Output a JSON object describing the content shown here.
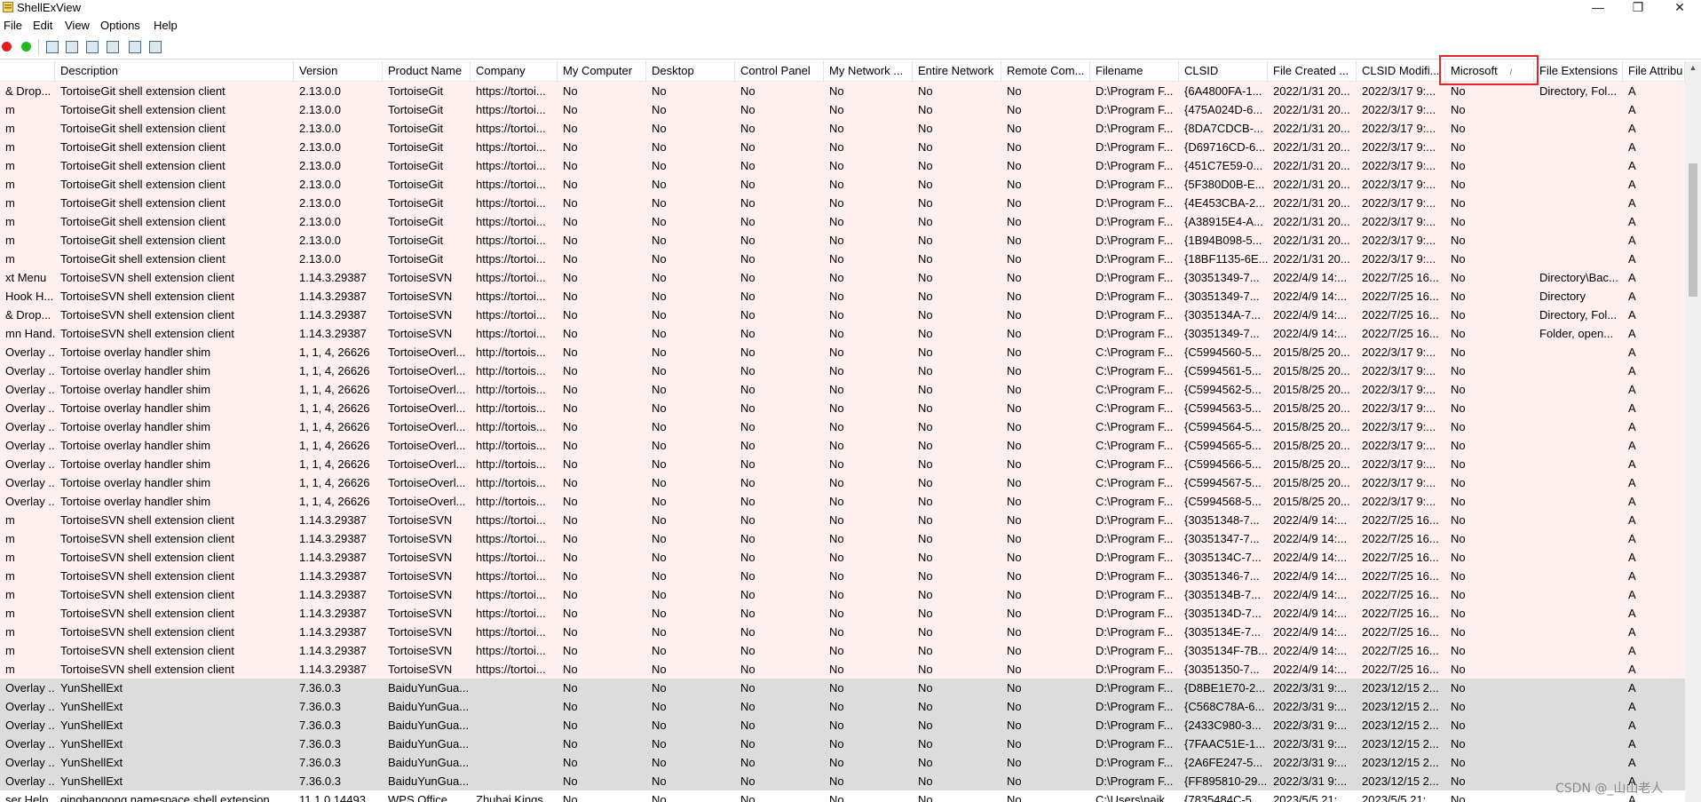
{
  "app": {
    "title": "ShellExView"
  },
  "window_controls": {
    "minimize": "—",
    "maximize": "❐",
    "close": "✕"
  },
  "menu": [
    "File",
    "Edit",
    "View",
    "Options",
    "Help"
  ],
  "toolbar": {
    "icons": [
      "disable-red-icon",
      "enable-green-icon",
      "save-icon",
      "refresh-icon",
      "copy-icon",
      "properties-icon",
      "html-report-icon",
      "exit-icon"
    ],
    "colors": {
      "red": "#e02020",
      "green": "#1fb81f"
    }
  },
  "columns": [
    "",
    "Description",
    "Version",
    "Product Name",
    "Company",
    "My Computer",
    "Desktop",
    "Control Panel",
    "My Network ...",
    "Entire Network",
    "Remote Com...",
    "Filename",
    "CLSID",
    "File Created ...",
    "CLSID Modifi...",
    "Microsoft",
    "File Extensions",
    "File Attribu"
  ],
  "sorted_column": "Microsoft",
  "sort_indicator": "/",
  "colors": {
    "pink_row": "#fff0f0",
    "gray_row": "#dcdcdc",
    "highlight": "#e1262d"
  },
  "rows": [
    {
      "style": "pink",
      "cells": [
        "& Drop...",
        "TortoiseGit shell extension client",
        "2.13.0.0",
        "TortoiseGit",
        "https://tortoi...",
        "No",
        "No",
        "No",
        "No",
        "No",
        "No",
        "D:\\Program F...",
        "{6A4800FA-1...",
        "2022/1/31 20...",
        "2022/3/17 9:...",
        "No",
        "Directory, Fol...",
        "A"
      ]
    },
    {
      "style": "pink",
      "cells": [
        "m",
        "TortoiseGit shell extension client",
        "2.13.0.0",
        "TortoiseGit",
        "https://tortoi...",
        "No",
        "No",
        "No",
        "No",
        "No",
        "No",
        "D:\\Program F...",
        "{475A024D-6...",
        "2022/1/31 20...",
        "2022/3/17 9:...",
        "No",
        "",
        "A"
      ]
    },
    {
      "style": "pink",
      "cells": [
        "m",
        "TortoiseGit shell extension client",
        "2.13.0.0",
        "TortoiseGit",
        "https://tortoi...",
        "No",
        "No",
        "No",
        "No",
        "No",
        "No",
        "D:\\Program F...",
        "{8DA7CDCB-...",
        "2022/1/31 20...",
        "2022/3/17 9:...",
        "No",
        "",
        "A"
      ]
    },
    {
      "style": "pink",
      "cells": [
        "m",
        "TortoiseGit shell extension client",
        "2.13.0.0",
        "TortoiseGit",
        "https://tortoi...",
        "No",
        "No",
        "No",
        "No",
        "No",
        "No",
        "D:\\Program F...",
        "{D69716CD-6...",
        "2022/1/31 20...",
        "2022/3/17 9:...",
        "No",
        "",
        "A"
      ]
    },
    {
      "style": "pink",
      "cells": [
        "m",
        "TortoiseGit shell extension client",
        "2.13.0.0",
        "TortoiseGit",
        "https://tortoi...",
        "No",
        "No",
        "No",
        "No",
        "No",
        "No",
        "D:\\Program F...",
        "{451C7E59-0...",
        "2022/1/31 20...",
        "2022/3/17 9:...",
        "No",
        "",
        "A"
      ]
    },
    {
      "style": "pink",
      "cells": [
        "m",
        "TortoiseGit shell extension client",
        "2.13.0.0",
        "TortoiseGit",
        "https://tortoi...",
        "No",
        "No",
        "No",
        "No",
        "No",
        "No",
        "D:\\Program F...",
        "{5F380D0B-E...",
        "2022/1/31 20...",
        "2022/3/17 9:...",
        "No",
        "",
        "A"
      ]
    },
    {
      "style": "pink",
      "cells": [
        "m",
        "TortoiseGit shell extension client",
        "2.13.0.0",
        "TortoiseGit",
        "https://tortoi...",
        "No",
        "No",
        "No",
        "No",
        "No",
        "No",
        "D:\\Program F...",
        "{4E453CBA-2...",
        "2022/1/31 20...",
        "2022/3/17 9:...",
        "No",
        "",
        "A"
      ]
    },
    {
      "style": "pink",
      "cells": [
        "m",
        "TortoiseGit shell extension client",
        "2.13.0.0",
        "TortoiseGit",
        "https://tortoi...",
        "No",
        "No",
        "No",
        "No",
        "No",
        "No",
        "D:\\Program F...",
        "{A38915E4-A...",
        "2022/1/31 20...",
        "2022/3/17 9:...",
        "No",
        "",
        "A"
      ]
    },
    {
      "style": "pink",
      "cells": [
        "m",
        "TortoiseGit shell extension client",
        "2.13.0.0",
        "TortoiseGit",
        "https://tortoi...",
        "No",
        "No",
        "No",
        "No",
        "No",
        "No",
        "D:\\Program F...",
        "{1B94B098-5...",
        "2022/1/31 20...",
        "2022/3/17 9:...",
        "No",
        "",
        "A"
      ]
    },
    {
      "style": "pink",
      "cells": [
        "m",
        "TortoiseGit shell extension client",
        "2.13.0.0",
        "TortoiseGit",
        "https://tortoi...",
        "No",
        "No",
        "No",
        "No",
        "No",
        "No",
        "D:\\Program F...",
        "{18BF1135-6E...",
        "2022/1/31 20...",
        "2022/3/17 9:...",
        "No",
        "",
        "A"
      ]
    },
    {
      "style": "pink",
      "cells": [
        "xt Menu",
        "TortoiseSVN shell extension client",
        "1.14.3.29387",
        "TortoiseSVN",
        "https://tortoi...",
        "No",
        "No",
        "No",
        "No",
        "No",
        "No",
        "D:\\Program F...",
        "{30351349-7...",
        "2022/4/9 14:...",
        "2022/7/25 16...",
        "No",
        "Directory\\Bac...",
        "A"
      ]
    },
    {
      "style": "pink",
      "cells": [
        "Hook H...",
        "TortoiseSVN shell extension client",
        "1.14.3.29387",
        "TortoiseSVN",
        "https://tortoi...",
        "No",
        "No",
        "No",
        "No",
        "No",
        "No",
        "D:\\Program F...",
        "{30351349-7...",
        "2022/4/9 14:...",
        "2022/7/25 16...",
        "No",
        "Directory",
        "A"
      ]
    },
    {
      "style": "pink",
      "cells": [
        "& Drop...",
        "TortoiseSVN shell extension client",
        "1.14.3.29387",
        "TortoiseSVN",
        "https://tortoi...",
        "No",
        "No",
        "No",
        "No",
        "No",
        "No",
        "D:\\Program F...",
        "{3035134A-7...",
        "2022/4/9 14:...",
        "2022/7/25 16...",
        "No",
        "Directory, Fol...",
        "A"
      ]
    },
    {
      "style": "pink",
      "cells": [
        "mn Hand...",
        "TortoiseSVN shell extension client",
        "1.14.3.29387",
        "TortoiseSVN",
        "https://tortoi...",
        "No",
        "No",
        "No",
        "No",
        "No",
        "No",
        "D:\\Program F...",
        "{30351349-7...",
        "2022/4/9 14:...",
        "2022/7/25 16...",
        "No",
        "Folder, open...",
        "A"
      ]
    },
    {
      "style": "pink",
      "cells": [
        "Overlay ...",
        "Tortoise overlay handler shim",
        "1, 1, 4, 26626",
        "TortoiseOverl...",
        "http://tortois...",
        "No",
        "No",
        "No",
        "No",
        "No",
        "No",
        "C:\\Program F...",
        "{C5994560-5...",
        "2015/8/25 20...",
        "2022/3/17 9:...",
        "No",
        "",
        "A"
      ]
    },
    {
      "style": "pink",
      "cells": [
        "Overlay ...",
        "Tortoise overlay handler shim",
        "1, 1, 4, 26626",
        "TortoiseOverl...",
        "http://tortois...",
        "No",
        "No",
        "No",
        "No",
        "No",
        "No",
        "C:\\Program F...",
        "{C5994561-5...",
        "2015/8/25 20...",
        "2022/3/17 9:...",
        "No",
        "",
        "A"
      ]
    },
    {
      "style": "pink",
      "cells": [
        "Overlay ...",
        "Tortoise overlay handler shim",
        "1, 1, 4, 26626",
        "TortoiseOverl...",
        "http://tortois...",
        "No",
        "No",
        "No",
        "No",
        "No",
        "No",
        "C:\\Program F...",
        "{C5994562-5...",
        "2015/8/25 20...",
        "2022/3/17 9:...",
        "No",
        "",
        "A"
      ]
    },
    {
      "style": "pink",
      "cells": [
        "Overlay ...",
        "Tortoise overlay handler shim",
        "1, 1, 4, 26626",
        "TortoiseOverl...",
        "http://tortois...",
        "No",
        "No",
        "No",
        "No",
        "No",
        "No",
        "C:\\Program F...",
        "{C5994563-5...",
        "2015/8/25 20...",
        "2022/3/17 9:...",
        "No",
        "",
        "A"
      ]
    },
    {
      "style": "pink",
      "cells": [
        "Overlay ...",
        "Tortoise overlay handler shim",
        "1, 1, 4, 26626",
        "TortoiseOverl...",
        "http://tortois...",
        "No",
        "No",
        "No",
        "No",
        "No",
        "No",
        "C:\\Program F...",
        "{C5994564-5...",
        "2015/8/25 20...",
        "2022/3/17 9:...",
        "No",
        "",
        "A"
      ]
    },
    {
      "style": "pink",
      "cells": [
        "Overlay ...",
        "Tortoise overlay handler shim",
        "1, 1, 4, 26626",
        "TortoiseOverl...",
        "http://tortois...",
        "No",
        "No",
        "No",
        "No",
        "No",
        "No",
        "C:\\Program F...",
        "{C5994565-5...",
        "2015/8/25 20...",
        "2022/3/17 9:...",
        "No",
        "",
        "A"
      ]
    },
    {
      "style": "pink",
      "cells": [
        "Overlay ...",
        "Tortoise overlay handler shim",
        "1, 1, 4, 26626",
        "TortoiseOverl...",
        "http://tortois...",
        "No",
        "No",
        "No",
        "No",
        "No",
        "No",
        "C:\\Program F...",
        "{C5994566-5...",
        "2015/8/25 20...",
        "2022/3/17 9:...",
        "No",
        "",
        "A"
      ]
    },
    {
      "style": "pink",
      "cells": [
        "Overlay ...",
        "Tortoise overlay handler shim",
        "1, 1, 4, 26626",
        "TortoiseOverl...",
        "http://tortois...",
        "No",
        "No",
        "No",
        "No",
        "No",
        "No",
        "C:\\Program F...",
        "{C5994567-5...",
        "2015/8/25 20...",
        "2022/3/17 9:...",
        "No",
        "",
        "A"
      ]
    },
    {
      "style": "pink",
      "cells": [
        "Overlay ...",
        "Tortoise overlay handler shim",
        "1, 1, 4, 26626",
        "TortoiseOverl...",
        "http://tortois...",
        "No",
        "No",
        "No",
        "No",
        "No",
        "No",
        "C:\\Program F...",
        "{C5994568-5...",
        "2015/8/25 20...",
        "2022/3/17 9:...",
        "No",
        "",
        "A"
      ]
    },
    {
      "style": "pink",
      "cells": [
        "m",
        "TortoiseSVN shell extension client",
        "1.14.3.29387",
        "TortoiseSVN",
        "https://tortoi...",
        "No",
        "No",
        "No",
        "No",
        "No",
        "No",
        "D:\\Program F...",
        "{30351348-7...",
        "2022/4/9 14:...",
        "2022/7/25 16...",
        "No",
        "",
        "A"
      ]
    },
    {
      "style": "pink",
      "cells": [
        "m",
        "TortoiseSVN shell extension client",
        "1.14.3.29387",
        "TortoiseSVN",
        "https://tortoi...",
        "No",
        "No",
        "No",
        "No",
        "No",
        "No",
        "D:\\Program F...",
        "{30351347-7...",
        "2022/4/9 14:...",
        "2022/7/25 16...",
        "No",
        "",
        "A"
      ]
    },
    {
      "style": "pink",
      "cells": [
        "m",
        "TortoiseSVN shell extension client",
        "1.14.3.29387",
        "TortoiseSVN",
        "https://tortoi...",
        "No",
        "No",
        "No",
        "No",
        "No",
        "No",
        "D:\\Program F...",
        "{3035134C-7...",
        "2022/4/9 14:...",
        "2022/7/25 16...",
        "No",
        "",
        "A"
      ]
    },
    {
      "style": "pink",
      "cells": [
        "m",
        "TortoiseSVN shell extension client",
        "1.14.3.29387",
        "TortoiseSVN",
        "https://tortoi...",
        "No",
        "No",
        "No",
        "No",
        "No",
        "No",
        "D:\\Program F...",
        "{30351346-7...",
        "2022/4/9 14:...",
        "2022/7/25 16...",
        "No",
        "",
        "A"
      ]
    },
    {
      "style": "pink",
      "cells": [
        "m",
        "TortoiseSVN shell extension client",
        "1.14.3.29387",
        "TortoiseSVN",
        "https://tortoi...",
        "No",
        "No",
        "No",
        "No",
        "No",
        "No",
        "D:\\Program F...",
        "{3035134B-7...",
        "2022/4/9 14:...",
        "2022/7/25 16...",
        "No",
        "",
        "A"
      ]
    },
    {
      "style": "pink",
      "cells": [
        "m",
        "TortoiseSVN shell extension client",
        "1.14.3.29387",
        "TortoiseSVN",
        "https://tortoi...",
        "No",
        "No",
        "No",
        "No",
        "No",
        "No",
        "D:\\Program F...",
        "{3035134D-7...",
        "2022/4/9 14:...",
        "2022/7/25 16...",
        "No",
        "",
        "A"
      ]
    },
    {
      "style": "pink",
      "cells": [
        "m",
        "TortoiseSVN shell extension client",
        "1.14.3.29387",
        "TortoiseSVN",
        "https://tortoi...",
        "No",
        "No",
        "No",
        "No",
        "No",
        "No",
        "D:\\Program F...",
        "{3035134E-7...",
        "2022/4/9 14:...",
        "2022/7/25 16...",
        "No",
        "",
        "A"
      ]
    },
    {
      "style": "pink",
      "cells": [
        "m",
        "TortoiseSVN shell extension client",
        "1.14.3.29387",
        "TortoiseSVN",
        "https://tortoi...",
        "No",
        "No",
        "No",
        "No",
        "No",
        "No",
        "D:\\Program F...",
        "{3035134F-7B...",
        "2022/4/9 14:...",
        "2022/7/25 16...",
        "No",
        "",
        "A"
      ]
    },
    {
      "style": "pink",
      "cells": [
        "m",
        "TortoiseSVN shell extension client",
        "1.14.3.29387",
        "TortoiseSVN",
        "https://tortoi...",
        "No",
        "No",
        "No",
        "No",
        "No",
        "No",
        "D:\\Program F...",
        "{30351350-7...",
        "2022/4/9 14:...",
        "2022/7/25 16...",
        "No",
        "",
        "A"
      ]
    },
    {
      "style": "gray",
      "cells": [
        "Overlay ...",
        "YunShellExt",
        "7.36.0.3",
        "BaiduYunGua...",
        "",
        "No",
        "No",
        "No",
        "No",
        "No",
        "No",
        "D:\\Program F...",
        "{D8BE1E70-2...",
        "2022/3/31 9:...",
        "2023/12/15 2...",
        "No",
        "",
        "A"
      ]
    },
    {
      "style": "gray",
      "cells": [
        "Overlay ...",
        "YunShellExt",
        "7.36.0.3",
        "BaiduYunGua...",
        "",
        "No",
        "No",
        "No",
        "No",
        "No",
        "No",
        "D:\\Program F...",
        "{C568C78A-6...",
        "2022/3/31 9:...",
        "2023/12/15 2...",
        "No",
        "",
        "A"
      ]
    },
    {
      "style": "gray",
      "cells": [
        "Overlay ...",
        "YunShellExt",
        "7.36.0.3",
        "BaiduYunGua...",
        "",
        "No",
        "No",
        "No",
        "No",
        "No",
        "No",
        "D:\\Program F...",
        "{2433C980-3...",
        "2022/3/31 9:...",
        "2023/12/15 2...",
        "No",
        "",
        "A"
      ]
    },
    {
      "style": "gray",
      "cells": [
        "Overlay ...",
        "YunShellExt",
        "7.36.0.3",
        "BaiduYunGua...",
        "",
        "No",
        "No",
        "No",
        "No",
        "No",
        "No",
        "D:\\Program F...",
        "{7FAAC51E-1...",
        "2022/3/31 9:...",
        "2023/12/15 2...",
        "No",
        "",
        "A"
      ]
    },
    {
      "style": "gray",
      "cells": [
        "Overlay ...",
        "YunShellExt",
        "7.36.0.3",
        "BaiduYunGua...",
        "",
        "No",
        "No",
        "No",
        "No",
        "No",
        "No",
        "D:\\Program F...",
        "{2A6FE247-5...",
        "2022/3/31 9:...",
        "2023/12/15 2...",
        "No",
        "",
        "A"
      ]
    },
    {
      "style": "gray",
      "cells": [
        "Overlay ...",
        "YunShellExt",
        "7.36.0.3",
        "BaiduYunGua...",
        "",
        "No",
        "No",
        "No",
        "No",
        "No",
        "No",
        "D:\\Program F...",
        "{FF895810-29...",
        "2022/3/31 9:...",
        "2023/12/15 2...",
        "No",
        "",
        "A"
      ]
    },
    {
      "style": "white",
      "cells": [
        "ser Help...",
        "qinghangong namespace shell extension",
        "11.1.0.14493",
        "WPS Office",
        "Zhuhai Kings...",
        "No",
        "No",
        "No",
        "No",
        "No",
        "No",
        "C:\\Users\\naik...",
        "{7835484C-5...",
        "2023/5/5 21:...",
        "2023/5/5 21:...",
        "No",
        "",
        "A"
      ]
    }
  ],
  "watermark": "CSDN @_山山老人"
}
